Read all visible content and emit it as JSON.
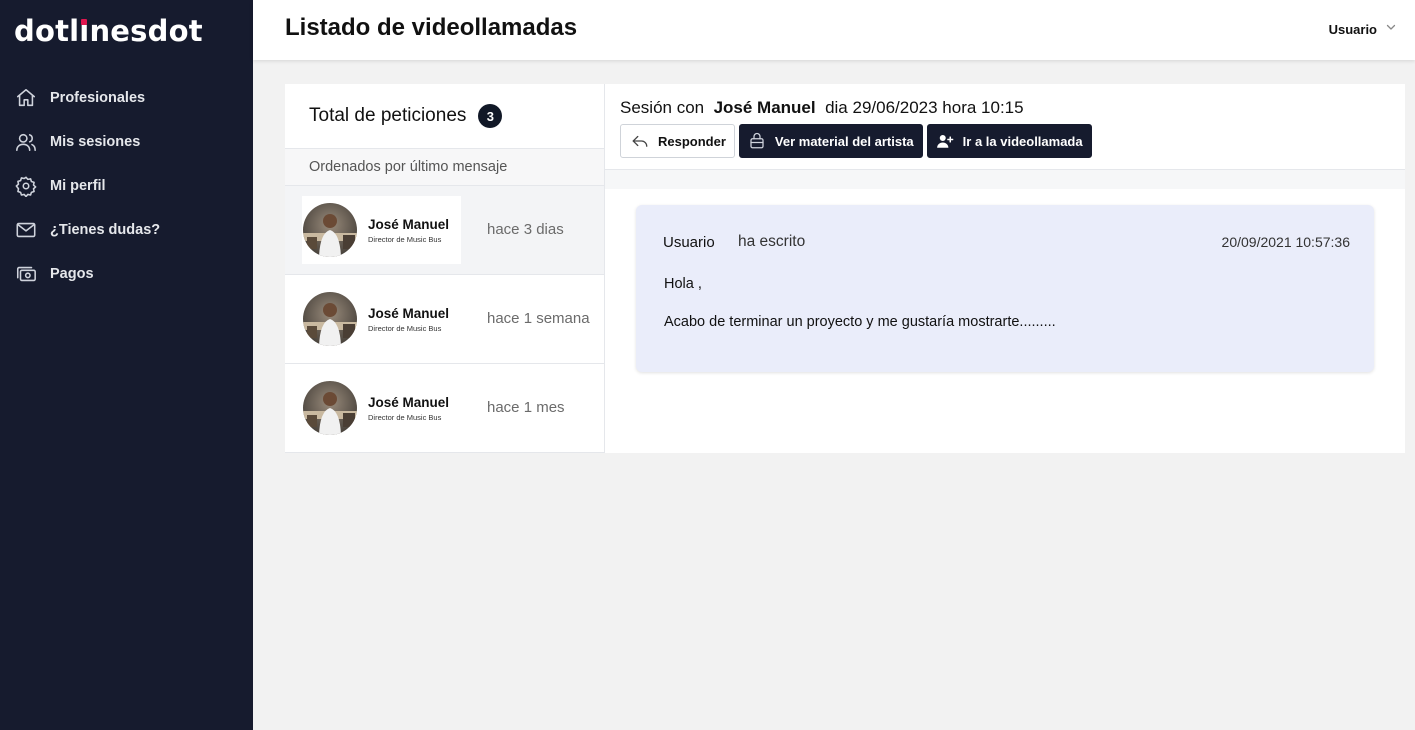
{
  "brand": {
    "logo_prefix": "dotl",
    "logo_i": "ı",
    "logo_suffix": "nesdot",
    "accent_color": "#e0164f"
  },
  "sidebar": {
    "items": [
      {
        "label": "Profesionales",
        "icon": "home-icon"
      },
      {
        "label": "Mis sesiones",
        "icon": "users-icon"
      },
      {
        "label": "Mi perfil",
        "icon": "gear-icon"
      },
      {
        "label": "¿Tienes dudas?",
        "icon": "mail-icon"
      },
      {
        "label": "Pagos",
        "icon": "cash-icon"
      }
    ]
  },
  "header": {
    "title": "Listado de videollamadas",
    "user_label": "Usuario"
  },
  "requests": {
    "title": "Total de peticiones",
    "count": "3",
    "sort_label": "Ordenados por último mensaje",
    "items": [
      {
        "name": "José Manuel",
        "role": "Director de Music Bus",
        "time": "hace 3 dias"
      },
      {
        "name": "José Manuel",
        "role": "Director de Music Bus",
        "time": "hace 1 semana"
      },
      {
        "name": "José Manuel",
        "role": "Director de Music Bus",
        "time": "hace 1 mes"
      }
    ]
  },
  "session": {
    "prefix": "Sesión con",
    "name": "José Manuel",
    "suffix": "dia 29/06/2023 hora 10:15",
    "actions": {
      "reply": "Responder",
      "material": "Ver material del artista",
      "call": "Ir a la videollamada"
    }
  },
  "message": {
    "author": "Usuario",
    "verb": "ha escrito",
    "date": "20/09/2021 10:57:36",
    "greeting": "Hola ,",
    "body": "Acabo de terminar un proyecto y me gustaría mostrarte.........",
    "background": "#eaedfa"
  },
  "colors": {
    "sidebar_bg": "#161b2e",
    "button_dark": "#161b2e"
  }
}
